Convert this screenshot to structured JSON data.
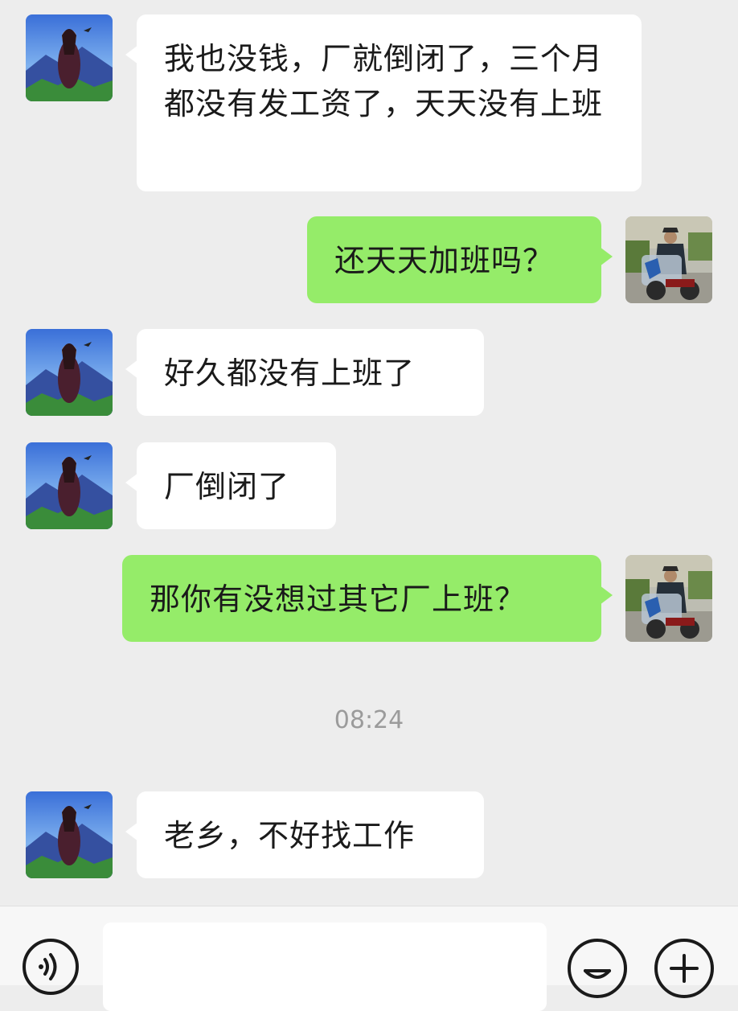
{
  "messages": [
    {
      "direction": "incoming",
      "text": "我也没钱，厂就倒闭了，三个月都没有发工资了，天天没有上班"
    },
    {
      "direction": "outgoing",
      "text": "还天天加班吗？"
    },
    {
      "direction": "incoming",
      "text": "好久都没有上班了"
    },
    {
      "direction": "incoming",
      "text": "厂倒闭了"
    },
    {
      "direction": "outgoing",
      "text": "那你有没想过其它厂上班？"
    },
    {
      "direction": "incoming",
      "text": "老乡，不好找工作"
    }
  ],
  "timestamp": "08:24",
  "input_bar": {
    "placeholder": "",
    "value": "",
    "voice_icon": "voice-icon",
    "emoji_icon": "emoji-icon",
    "plus_icon": "plus-icon"
  },
  "colors": {
    "background": "#ededed",
    "incoming_bubble": "#ffffff",
    "outgoing_bubble": "#95ec69",
    "timestamp": "#9b9b9b"
  }
}
